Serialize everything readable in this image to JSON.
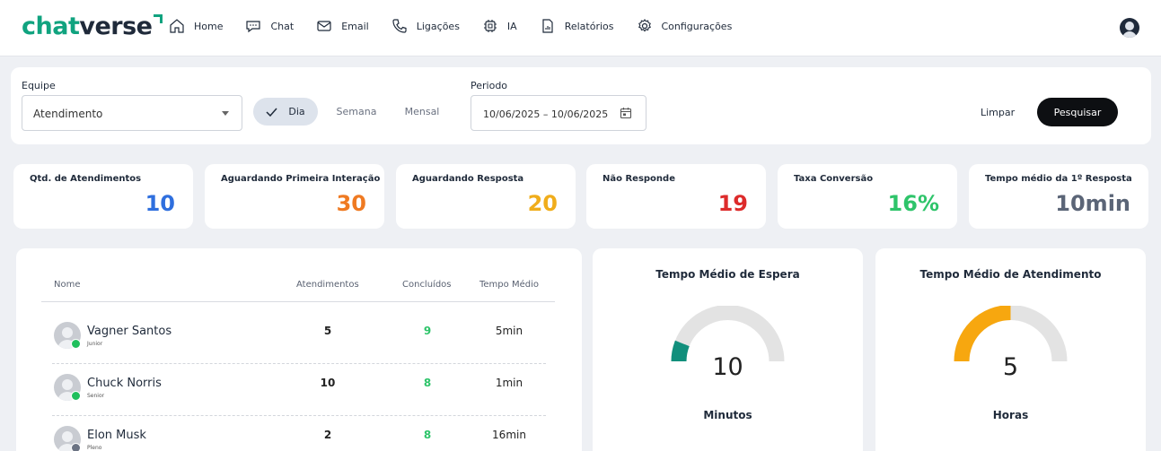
{
  "brand": {
    "name_part1": "chat",
    "name_part2": "verse",
    "accent": "#10a37f"
  },
  "nav": {
    "items": [
      {
        "label": "Home",
        "icon": "home-icon"
      },
      {
        "label": "Chat",
        "icon": "chat-bubble-icon"
      },
      {
        "label": "Email",
        "icon": "mail-icon"
      },
      {
        "label": "Ligações",
        "icon": "phone-icon"
      },
      {
        "label": "IA",
        "icon": "chip-icon"
      },
      {
        "label": "Relatórios",
        "icon": "report-icon"
      },
      {
        "label": "Configurações",
        "icon": "gear-icon"
      }
    ]
  },
  "filters": {
    "team_label": "Equipe",
    "team_value": "Atendimento",
    "period_options": [
      {
        "label": "Dia",
        "selected": true
      },
      {
        "label": "Semana",
        "selected": false
      },
      {
        "label": "Mensal",
        "selected": false
      }
    ],
    "period_label": "Periodo",
    "date_range": "10/06/2025 – 10/06/2025",
    "clear_label": "Limpar",
    "search_label": "Pesquisar"
  },
  "kpis": [
    {
      "title": "Qtd. de Atendimentos",
      "value": "10",
      "color": "#2f6fde"
    },
    {
      "title": "Aguardando Primeira Interação",
      "value": "30",
      "color": "#ef7a22"
    },
    {
      "title": "Aguardando Resposta",
      "value": "20",
      "color": "#f0ad1b"
    },
    {
      "title": "Não Responde",
      "value": "19",
      "color": "#dd2b2b"
    },
    {
      "title": "Taxa Conversão",
      "value": "16%",
      "color": "#2ec46a"
    },
    {
      "title": "Tempo médio da 1º Resposta",
      "value": "10min",
      "color": "#5b6577"
    }
  ],
  "agents_table": {
    "columns": [
      "Nome",
      "Atendimentos",
      "Concluídos",
      "Tempo Médio"
    ],
    "rows": [
      {
        "name": "Vagner Santos",
        "level": "Junior",
        "status_color": "#1fbf5c",
        "atendimentos": "5",
        "concluidos": "9",
        "tempo_medio": "5min"
      },
      {
        "name": "Chuck Norris",
        "level": "Senior",
        "status_color": "#1fbf5c",
        "atendimentos": "10",
        "concluidos": "8",
        "tempo_medio": "1min"
      },
      {
        "name": "Elon Musk",
        "level": "Pleno",
        "status_color": "#6b7383",
        "atendimentos": "2",
        "concluidos": "8",
        "tempo_medio": "16min"
      }
    ],
    "concluded_color": "#2ec46a"
  },
  "gauges": [
    {
      "title": "Tempo Médio de Espera",
      "value": "10",
      "unit": "Minutos",
      "fraction": 0.12,
      "color": "#118f7c"
    },
    {
      "title": "Tempo Médio de Atendimento",
      "value": "5",
      "unit": "Horas",
      "fraction": 0.5,
      "color": "#f7a70f"
    }
  ]
}
